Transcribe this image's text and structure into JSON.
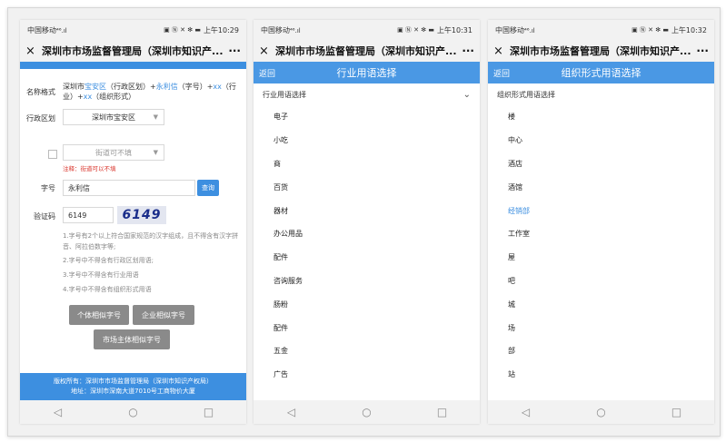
{
  "status_bars": [
    {
      "carrier": "中国移动",
      "time": "上午10:29"
    },
    {
      "carrier": "中国移动",
      "time": "上午10:31"
    },
    {
      "carrier": "中国移动",
      "time": "上午10:32"
    }
  ],
  "app_title": "深圳市市场监督管理局（深圳市知识产...",
  "more_label": "···",
  "close_label": "×",
  "phone1": {
    "name_format_label": "名称格式",
    "name_format_parts": [
      "深圳市",
      "宝安区",
      "（行政区划）+",
      "永利信",
      "（字号）+",
      "xx",
      "（行",
      "业）+",
      "xx",
      "（组织形式）"
    ],
    "district_label": "行政区划",
    "district_value": "深圳市宝安区",
    "street_placeholder": "街道可不填",
    "street_note": "注释：街道可以不填",
    "trade_name_label": "字号",
    "trade_name_value": "永利信",
    "query_button": "查询",
    "captcha_label": "验证码",
    "captcha_value": "6149",
    "captcha_image_text": "6149",
    "rules": [
      "1.字号有2个以上符合国家规范的汉字组成，且不得含有汉字拼音、阿拉伯数字等;",
      "2.字号中不得含有行政区划用语;",
      "3.字号中不得含有行业用语",
      "4.字号中不得含有组织形式用语"
    ],
    "btn_individual": "个体相似字号",
    "btn_enterprise": "企业相似字号",
    "btn_market": "市场主体相似字号",
    "footer_line1": "版权所有：深圳市市场监督管理局（深圳市知识产权局）",
    "footer_line2": "地址：深圳市深南大道7010号工商物价大厦"
  },
  "phone2": {
    "back": "返回",
    "title": "行业用语选择",
    "list_header": "行业用语选择",
    "items": [
      "电子",
      "小吃",
      "商",
      "百货",
      "器材",
      "办公用品",
      "配件",
      "咨询服务",
      "肠粉",
      "配件",
      "五金",
      "广告"
    ]
  },
  "phone3": {
    "back": "返回",
    "title": "组织形式用语选择",
    "list_header": "组织形式用语选择",
    "items": [
      "楼",
      "中心",
      "酒店",
      "酒馆",
      "经销部",
      "工作室",
      "屋",
      "吧",
      "城",
      "场",
      "部",
      "站"
    ],
    "selected_item": "经销部"
  },
  "nav_icons": [
    "back-triangle-icon",
    "home-circle-icon",
    "recent-square-icon"
  ],
  "colors": {
    "accent": "#3d8fe0",
    "danger": "#d9342b"
  }
}
